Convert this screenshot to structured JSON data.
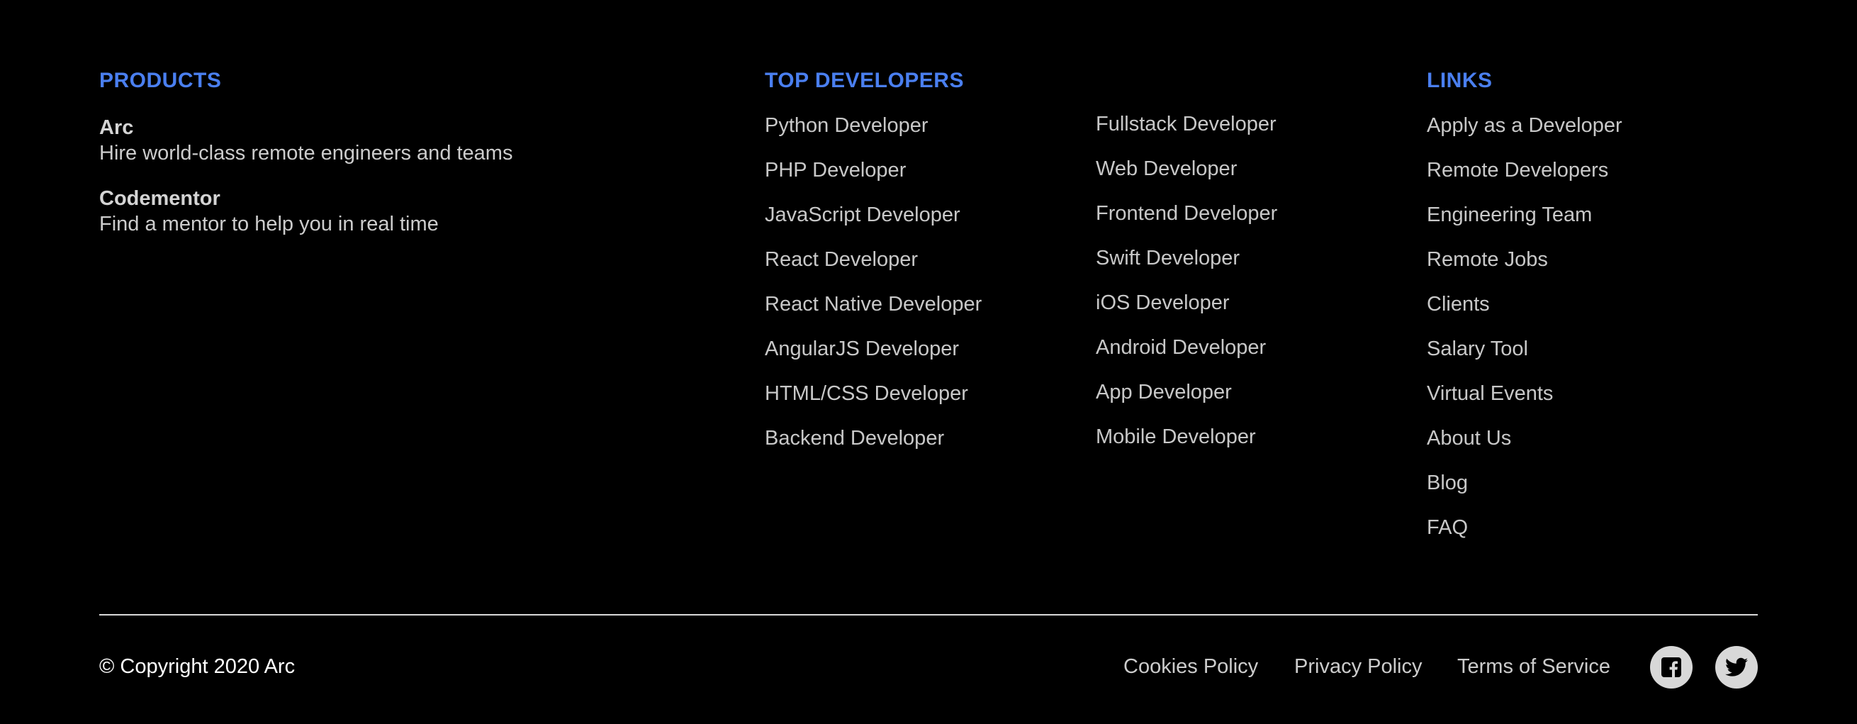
{
  "products": {
    "heading": "PRODUCTS",
    "items": [
      {
        "name": "Arc",
        "description": "Hire world-class remote engineers and teams"
      },
      {
        "name": "Codementor",
        "description": "Find a mentor to help you in real time"
      }
    ]
  },
  "top_developers": {
    "heading": "TOP DEVELOPERS",
    "column1": [
      "Python Developer",
      "PHP Developer",
      "JavaScript Developer",
      "React Developer",
      "React Native Developer",
      "AngularJS Developer",
      "HTML/CSS Developer",
      "Backend Developer"
    ],
    "column2": [
      "Fullstack Developer",
      "Web Developer",
      "Frontend Developer",
      "Swift Developer",
      "iOS Developer",
      "Android Developer",
      "App Developer",
      "Mobile Developer"
    ]
  },
  "links": {
    "heading": "LINKS",
    "items": [
      "Apply as a Developer",
      "Remote Developers",
      "Engineering Team",
      "Remote Jobs",
      "Clients",
      "Salary Tool",
      "Virtual Events",
      "About Us",
      "Blog",
      "FAQ"
    ]
  },
  "bottom": {
    "copyright": "© Copyright 2020 Arc",
    "cookies": "Cookies Policy",
    "privacy": "Privacy Policy",
    "terms": "Terms of Service",
    "social_icons": [
      "facebook-icon",
      "twitter-icon"
    ]
  },
  "colors": {
    "background": "#000000",
    "heading_accent": "#4a7ff0",
    "link_text": "#c8c8c8",
    "divider": "#d9d9d9",
    "social_bg": "#d8d8d8"
  }
}
